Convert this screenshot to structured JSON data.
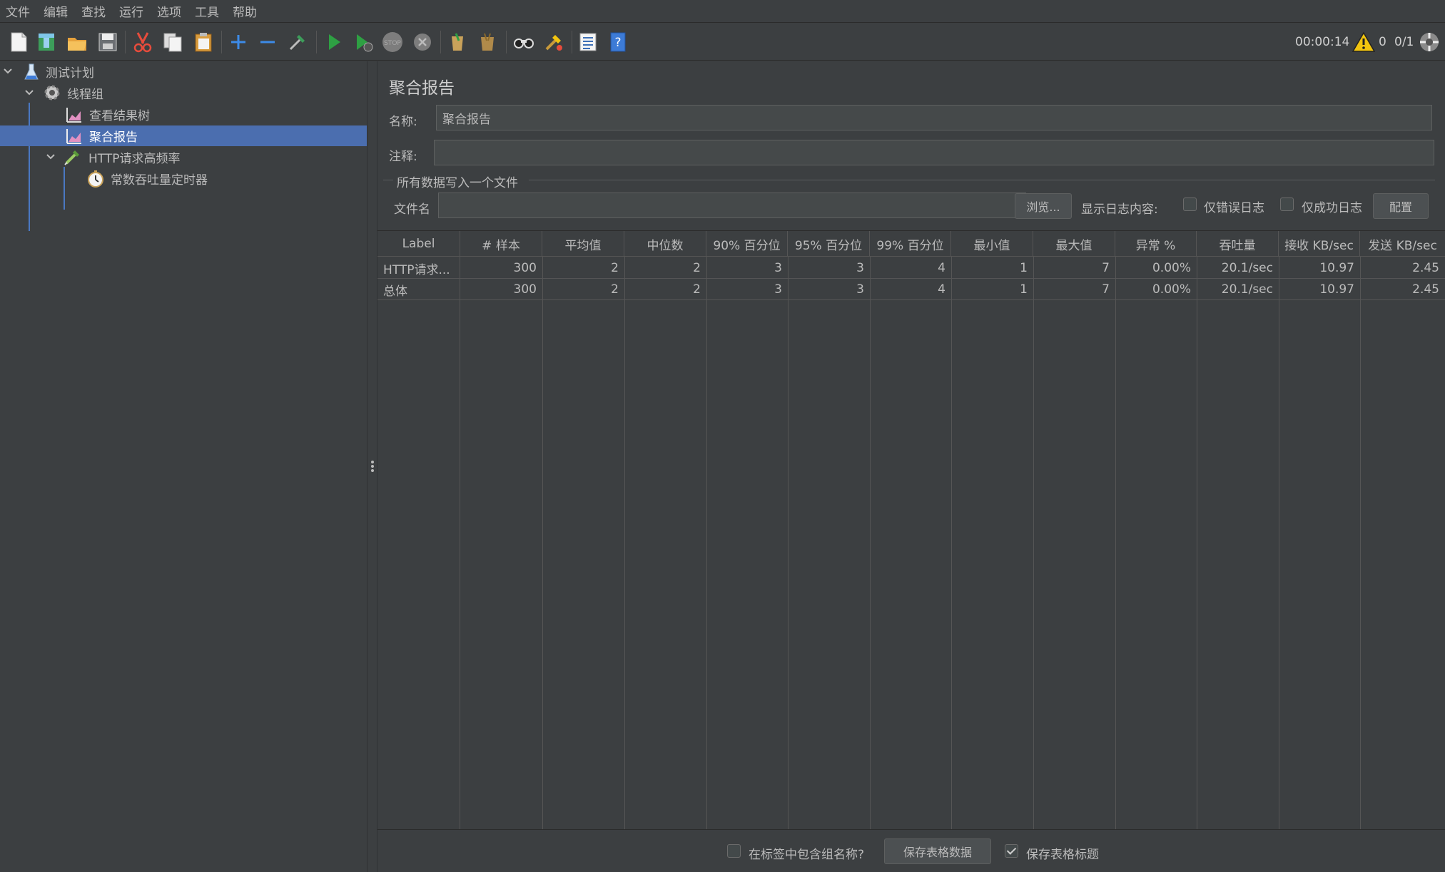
{
  "menu": [
    "文件",
    "编辑",
    "查找",
    "运行",
    "选项",
    "工具",
    "帮助"
  ],
  "toolbar": {
    "icons": [
      "new-icon",
      "templates-icon",
      "open-icon",
      "save-icon",
      "cut-icon",
      "copy-icon",
      "paste-icon",
      "expand-icon",
      "collapse-icon",
      "toggle-icon",
      "start-icon",
      "start-no-pause-icon",
      "stop-icon",
      "shutdown-icon",
      "clear-icon",
      "clear-all-icon",
      "search-icon",
      "reset-search-icon",
      "function-helper-icon",
      "help-icon"
    ],
    "timer": "00:00:14",
    "warnings": "0",
    "threads": "0/1"
  },
  "tree": {
    "items": [
      {
        "label": "测试计划",
        "icon": "flask-icon"
      },
      {
        "label": "线程组",
        "icon": "gear-icon"
      },
      {
        "label": "查看结果树",
        "icon": "graph-icon"
      },
      {
        "label": "聚合报告",
        "icon": "graph-icon"
      },
      {
        "label": "HTTP请求高频率",
        "icon": "pipette-icon"
      },
      {
        "label": "常数吞吐量定时器",
        "icon": "timer-icon"
      }
    ]
  },
  "panel": {
    "title": "聚合报告",
    "name_label": "名称:",
    "name_value": "聚合报告",
    "comment_label": "注释:",
    "comment_value": "",
    "group_title": "所有数据写入一个文件",
    "filename_label": "文件名",
    "filename_value": "",
    "browse_label": "浏览...",
    "log_display_label": "显示日志内容:",
    "errors_only_label": "仅错误日志",
    "success_only_label": "仅成功日志",
    "configure_label": "配置"
  },
  "table": {
    "headers": [
      "Label",
      "# 样本",
      "平均值",
      "中位数",
      "90% 百分位",
      "95% 百分位",
      "99% 百分位",
      "最小值",
      "最大值",
      "异常 %",
      "吞吐量",
      "接收 KB/sec",
      "发送 KB/sec"
    ],
    "rows": [
      [
        "HTTP请求...",
        "300",
        "2",
        "2",
        "3",
        "3",
        "4",
        "1",
        "7",
        "0.00%",
        "20.1/sec",
        "10.97",
        "2.45"
      ],
      [
        "总体",
        "300",
        "2",
        "2",
        "3",
        "3",
        "4",
        "1",
        "7",
        "0.00%",
        "20.1/sec",
        "10.97",
        "2.45"
      ]
    ]
  },
  "bottom": {
    "include_group_label": "在标签中包含组名称?",
    "include_group_checked": false,
    "save_data_label": "保存表格数据",
    "save_header_label": "保存表格标题",
    "save_header_checked": true
  },
  "colors": {
    "background": "#3c3f41",
    "selection": "#4b6eaf",
    "text": "#bbbbbb"
  }
}
